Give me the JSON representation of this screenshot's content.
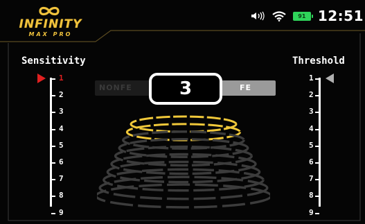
{
  "header": {
    "logo_title": "INFINITY",
    "logo_subtitle": "MAX PRO",
    "clock": "12:51",
    "battery_level": "91",
    "icons": [
      "infinity-icon",
      "speaker-icon",
      "wifi-icon",
      "battery-icon"
    ]
  },
  "sensitivity": {
    "label": "Sensitivity",
    "levels": [
      "1",
      "2",
      "3",
      "4",
      "5",
      "6",
      "7",
      "8",
      "9"
    ],
    "selected": "1"
  },
  "threshold": {
    "label": "Threshold",
    "levels": [
      "1",
      "2",
      "3",
      "4",
      "5",
      "6",
      "7",
      "8",
      "9"
    ],
    "selected": "1"
  },
  "discrimination": {
    "nonfe_label": "NONFE",
    "fe_label": "FE",
    "value": "3"
  },
  "colors": {
    "accent_gold": "#f0c23c",
    "active_red": "#e02020",
    "battery_green": "#2fd45a",
    "ring_active": "#f0c83a",
    "ring_inactive": "#3c3c3c"
  }
}
